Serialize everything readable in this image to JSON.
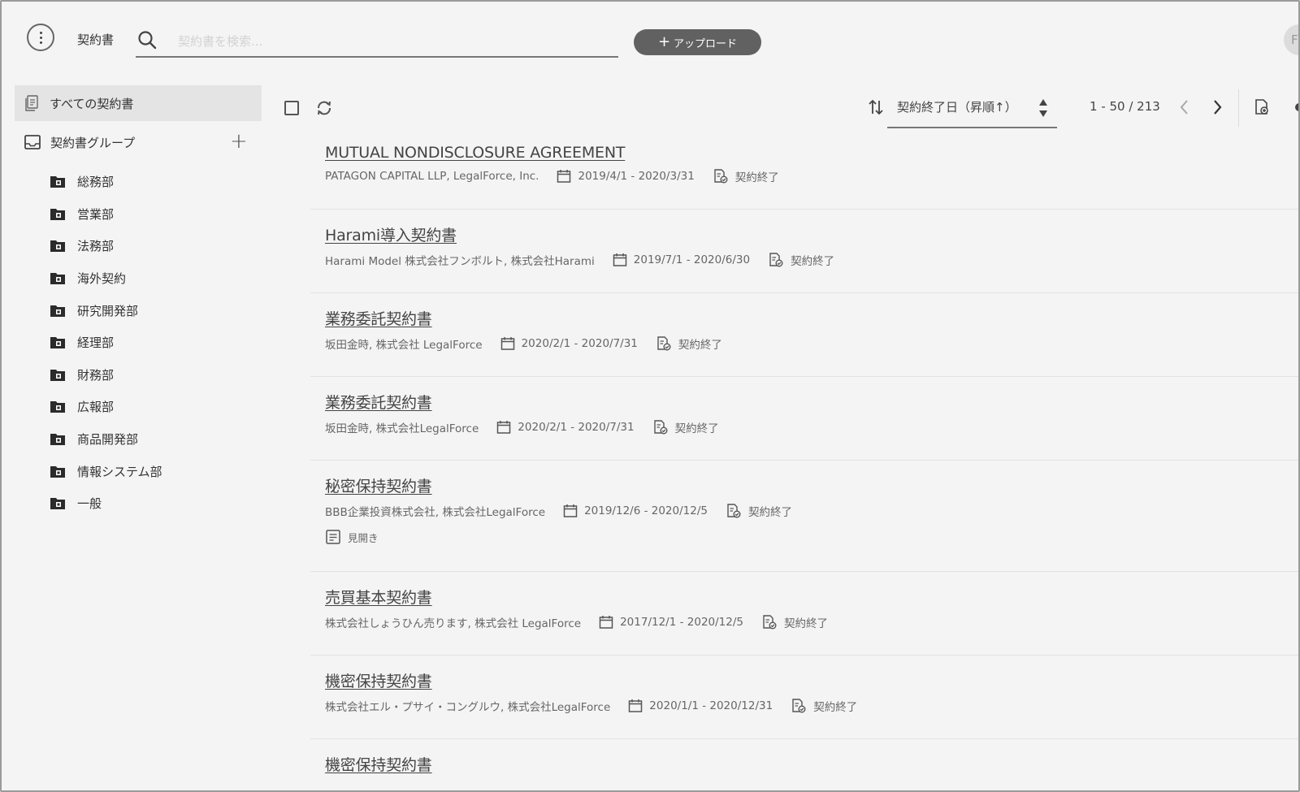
{
  "header": {
    "app_title": "契約書",
    "search_placeholder": "契約書を検索...",
    "upload_label": "アップロード",
    "avatar_initial": "F"
  },
  "sidebar": {
    "all_label": "すべての契約書",
    "group_label": "契約書グループ",
    "folders": [
      "総務部",
      "営業部",
      "法務部",
      "海外契約",
      "研究開発部",
      "経理部",
      "財務部",
      "広報部",
      "商品開発部",
      "情報システム部",
      "一般"
    ]
  },
  "toolbar": {
    "sort_label": "契約終了日（昇順↑）",
    "pagination": "1 - 50 / 213"
  },
  "contracts": [
    {
      "title": "MUTUAL NONDISCLOSURE AGREEMENT",
      "parties": "PATAGON CAPITAL LLP, LegalForce, Inc.",
      "period": "2019/4/1 - 2020/3/31",
      "status": "契約終了"
    },
    {
      "title": "Harami導入契約書",
      "parties": "Harami Model 株式会社フンボルト, 株式会社Harami",
      "period": "2019/7/1 - 2020/6/30",
      "status": "契約終了"
    },
    {
      "title": "業務委託契約書",
      "parties": "坂田金時, 株式会社 LegalForce",
      "period": "2020/2/1 - 2020/7/31",
      "status": "契約終了"
    },
    {
      "title": "業務委託契約書",
      "parties": "坂田金時, 株式会社LegalForce",
      "period": "2020/2/1 - 2020/7/31",
      "status": "契約終了"
    },
    {
      "title": "秘密保持契約書",
      "parties": "BBB企業投資株式会社, 株式会社LegalForce",
      "period": "2019/12/6 - 2020/12/5",
      "status": "契約終了",
      "extra": "見開き"
    },
    {
      "title": "売買基本契約書",
      "parties": "株式会社しょうひん売ります, 株式会社 LegalForce",
      "period": "2017/12/1 - 2020/12/5",
      "status": "契約終了"
    },
    {
      "title": "機密保持契約書",
      "parties": "株式会社エル・プサイ・コングルウ, 株式会社LegalForce",
      "period": "2020/1/1 - 2020/12/31",
      "status": "契約終了"
    },
    {
      "title": "機密保持契約書",
      "parties": "",
      "period": "",
      "status": ""
    }
  ]
}
